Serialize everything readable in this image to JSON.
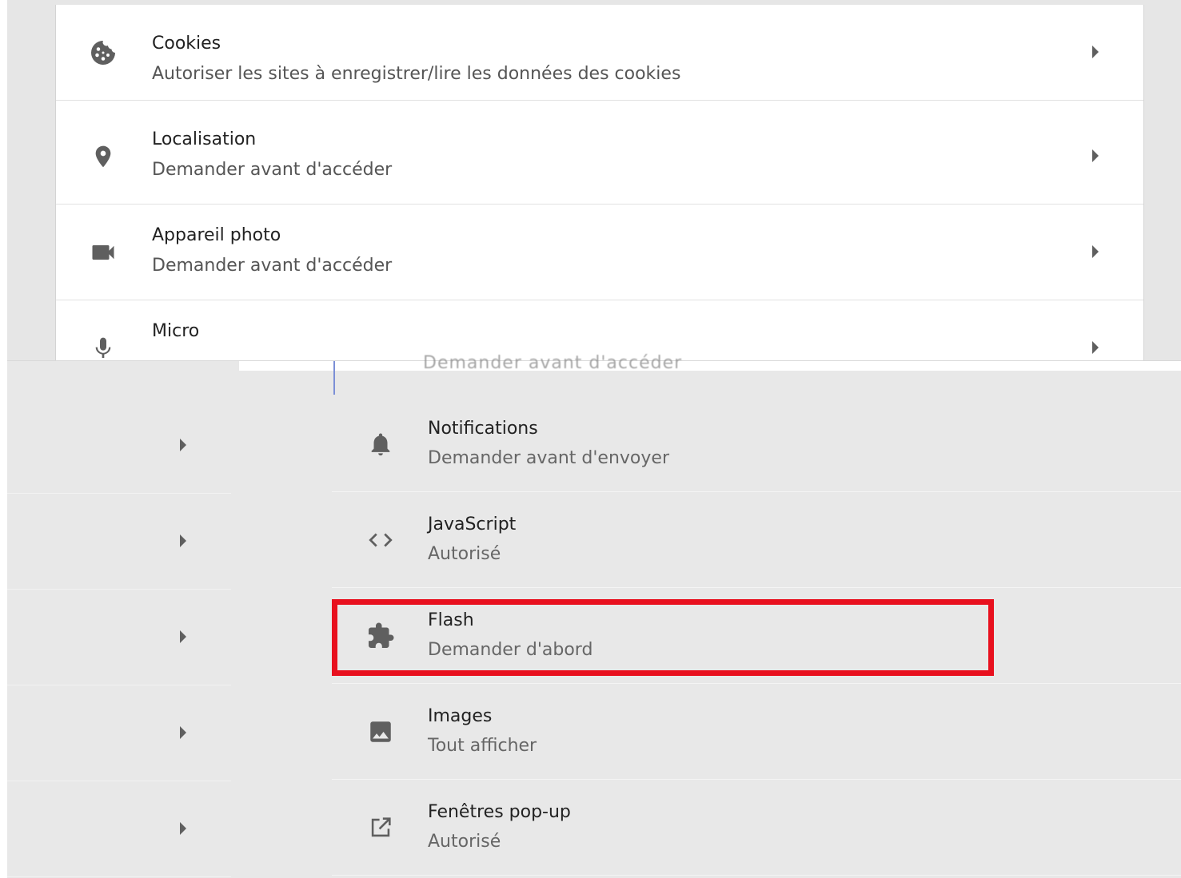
{
  "top_rows": [
    {
      "title": "Cookies",
      "subtitle": "Autoriser les sites à enregistrer/lire les données des cookies",
      "icon": "cookie-icon"
    },
    {
      "title": "Localisation",
      "subtitle": "Demander avant d'accéder",
      "icon": "location-pin-icon"
    },
    {
      "title": "Appareil photo",
      "subtitle": "Demander avant d'accéder",
      "icon": "camera-icon"
    },
    {
      "title": "Micro",
      "subtitle": "",
      "icon": "microphone-icon"
    }
  ],
  "glitch_text": "Demander avant d'accéder",
  "bottom_rows": [
    {
      "title": "Notifications",
      "subtitle": "Demander avant d'envoyer",
      "icon": "bell-icon"
    },
    {
      "title": "JavaScript",
      "subtitle": "Autorisé",
      "icon": "code-brackets-icon"
    },
    {
      "title": "Flash",
      "subtitle": "Demander d'abord",
      "icon": "puzzle-piece-icon"
    },
    {
      "title": "Images",
      "subtitle": "Tout afficher",
      "icon": "image-icon"
    },
    {
      "title": "Fenêtres pop-up",
      "subtitle": "Autorisé",
      "icon": "open-in-new-icon"
    }
  ],
  "colors": {
    "highlight": "#e8101e",
    "icon": "#5f5f5f"
  }
}
